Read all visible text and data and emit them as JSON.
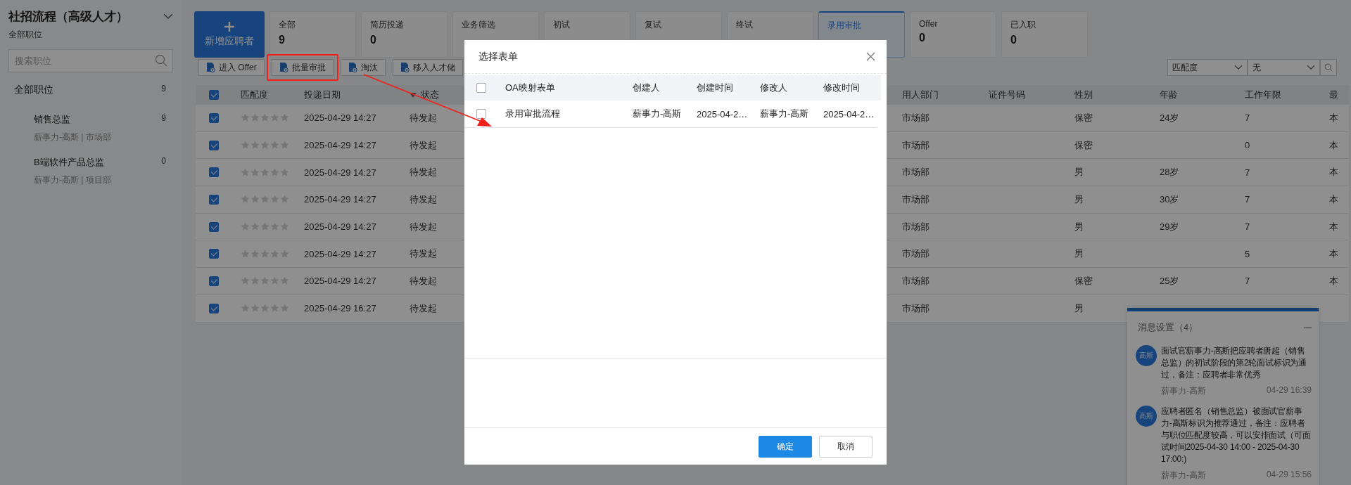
{
  "sidebar": {
    "title": "社招流程（高级人才）",
    "subtitle": "全部职位",
    "search": {
      "placeholder": "搜索职位"
    },
    "items": [
      {
        "label": "全部职位",
        "count": "9",
        "children": [
          {
            "label": "销售总监",
            "count": "9",
            "meta": "薪事力-高斯 | 市场部"
          },
          {
            "label": "B端软件产品总监",
            "count": "0",
            "meta": "薪事力-高斯 | 项目部"
          }
        ]
      }
    ]
  },
  "new_button": {
    "label": "新增应聘者"
  },
  "stages": [
    {
      "label": "全部",
      "count": "9",
      "selected": false
    },
    {
      "label": "简历投递",
      "count": "0",
      "selected": false
    },
    {
      "label": "业务筛选",
      "selected": false
    },
    {
      "label": "初试",
      "selected": false
    },
    {
      "label": "复试",
      "selected": false
    },
    {
      "label": "终试",
      "selected": false
    },
    {
      "label": "录用审批",
      "selected": true
    },
    {
      "label": "Offer",
      "count": "0",
      "selected": false
    },
    {
      "label": "已入职",
      "count": "0",
      "selected": false
    }
  ],
  "actions": [
    {
      "label": "进入 Offer",
      "highlighted": false
    },
    {
      "label": "批量审批",
      "highlighted": true
    },
    {
      "label": "淘汰",
      "highlighted": false
    },
    {
      "label": "移入人才储",
      "highlighted": false
    }
  ],
  "sort_field": {
    "value": "匹配度"
  },
  "sort_order": {
    "value": "无"
  },
  "table": {
    "all_checked": true,
    "columns": [
      "匹配度",
      "投递日期",
      "状态",
      "用人部门",
      "证件号码",
      "性别",
      "年龄",
      "工作年限",
      "最"
    ],
    "rows": [
      {
        "checked": true,
        "stars": 0,
        "date": "2025-04-29 14:27",
        "status": "待发起",
        "department": "市场部",
        "gender": "保密",
        "age": "24岁",
        "years": "7",
        "column_9": "本"
      },
      {
        "checked": true,
        "stars": 0,
        "date": "2025-04-29 14:27",
        "status": "待发起",
        "department": "市场部",
        "gender": "保密",
        "years": "0",
        "column_9": "本"
      },
      {
        "checked": true,
        "stars": 0,
        "date": "2025-04-29 14:27",
        "status": "待发起",
        "department": "市场部",
        "gender": "男",
        "age": "28岁",
        "years": "7",
        "column_9": "本"
      },
      {
        "checked": true,
        "stars": 0,
        "date": "2025-04-29 14:27",
        "status": "待发起",
        "department": "市场部",
        "gender": "男",
        "age": "30岁",
        "years": "7",
        "column_9": "本"
      },
      {
        "checked": true,
        "stars": 0,
        "date": "2025-04-29 14:27",
        "status": "待发起",
        "department": "市场部",
        "gender": "男",
        "age": "29岁",
        "years": "7",
        "column_9": "本"
      },
      {
        "checked": true,
        "stars": 0,
        "date": "2025-04-29 14:27",
        "status": "待发起",
        "department": "市场部",
        "gender": "男",
        "years": "5",
        "column_9": "本"
      },
      {
        "checked": true,
        "stars": 0,
        "date": "2025-04-29 14:27",
        "status": "待发起",
        "department": "市场部",
        "gender": "保密",
        "age": "25岁",
        "years": "7",
        "column_9": "本"
      },
      {
        "checked": true,
        "stars": 0,
        "date": "2025-04-29 16:27",
        "status": "待发起",
        "department": "市场部",
        "gender": "男"
      }
    ]
  },
  "dialog": {
    "title": "选择表单",
    "all_checked": false,
    "columns": [
      "OA映射表单",
      "创建人",
      "创建时间",
      "修改人",
      "修改时间"
    ],
    "rows": [
      {
        "checked": false,
        "cells": [
          "录用审批流程",
          "薪事力-高斯",
          "2025-04-2…",
          "薪事力-高斯",
          "2025-04-2…"
        ]
      }
    ],
    "buttons": [
      {
        "label": "确定",
        "kind": "primary"
      },
      {
        "label": "取消",
        "kind": "default"
      }
    ]
  },
  "notifications": {
    "title": "消息设置（4）",
    "items": [
      {
        "avatar": "高斯",
        "text": "面试官薪事力-高斯把应聘者唐超（销售总监）的初试阶段的第2轮面试标识为通过，备注：应聘者非常优秀",
        "author": "薪事力-高斯",
        "time": "04-29 16:39"
      },
      {
        "avatar": "高斯",
        "text": "应聘者匿名（销售总监）被面试官薪事力-高斯标识为推荐通过，备注：应聘者与职位匹配度较高，可以安排面试（可面试时间2025-04-30 14:00 - 2025-04-30 17:00:)",
        "author": "薪事力-高斯",
        "time": "04-29 15:56"
      }
    ]
  }
}
